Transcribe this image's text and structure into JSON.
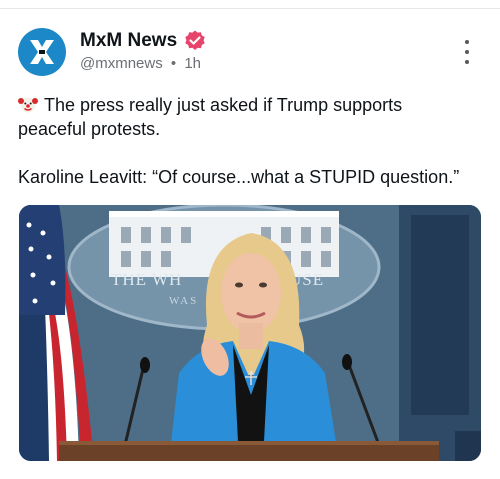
{
  "post": {
    "author_name": "MxM News",
    "handle": "@mxmnews",
    "separator": "•",
    "time": "1h",
    "text_line1": "The press really just asked if Trump supports",
    "text_line2": "peaceful protests.",
    "text_line3": "Karoline Leavitt: “Of course...what a STUPID question.”",
    "emoji": "clown-face-emoji"
  },
  "media": {
    "backdrop_text_left": "THE WH",
    "backdrop_text_right": "USE",
    "backdrop_sub": "WAS"
  },
  "icons": {
    "avatar": "mxm-logo-icon",
    "verified": "verified-badge-icon",
    "more": "more-options-icon"
  },
  "colors": {
    "avatar_bg": "#1d88c7",
    "verified": "#e8436a",
    "text": "#0f1419",
    "muted": "#6b6f74",
    "backdrop_blue": "#4e6f88",
    "jacket_blue": "#2a8fd8"
  }
}
